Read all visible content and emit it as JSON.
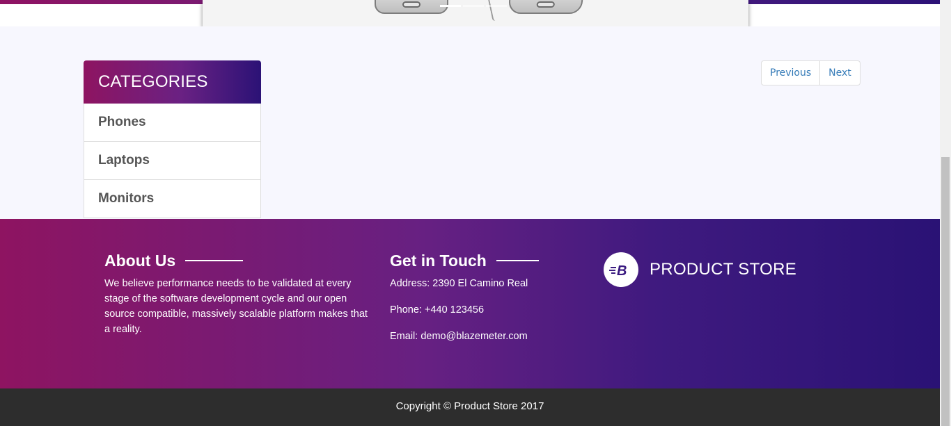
{
  "carousel": {
    "slide_count": 3,
    "active_slide": 1
  },
  "sidebar": {
    "title": "CATEGORIES",
    "items": [
      {
        "label": "Phones"
      },
      {
        "label": "Laptops"
      },
      {
        "label": "Monitors"
      }
    ]
  },
  "pager": {
    "previous_label": "Previous",
    "next_label": "Next"
  },
  "footer": {
    "about": {
      "title": "About Us",
      "text": "We believe performance needs to be validated at every stage of the software development cycle and our open source compatible, massively scalable platform makes that a reality."
    },
    "contact": {
      "title": "Get in Touch",
      "address": "Address: 2390 El Camino Real",
      "phone": "Phone: +440 123456",
      "email": "Email: demo@blazemeter.com"
    },
    "brand": {
      "name": "PRODUCT STORE",
      "logo_letter": "B"
    },
    "copyright": "Copyright © Product Store 2017"
  },
  "colors": {
    "gradient_start": "#8e1461",
    "gradient_end": "#2a1275",
    "link": "#337ab7",
    "footer_bar": "#2d2d2d"
  },
  "icons": [
    "blazemeter-logo-icon"
  ]
}
